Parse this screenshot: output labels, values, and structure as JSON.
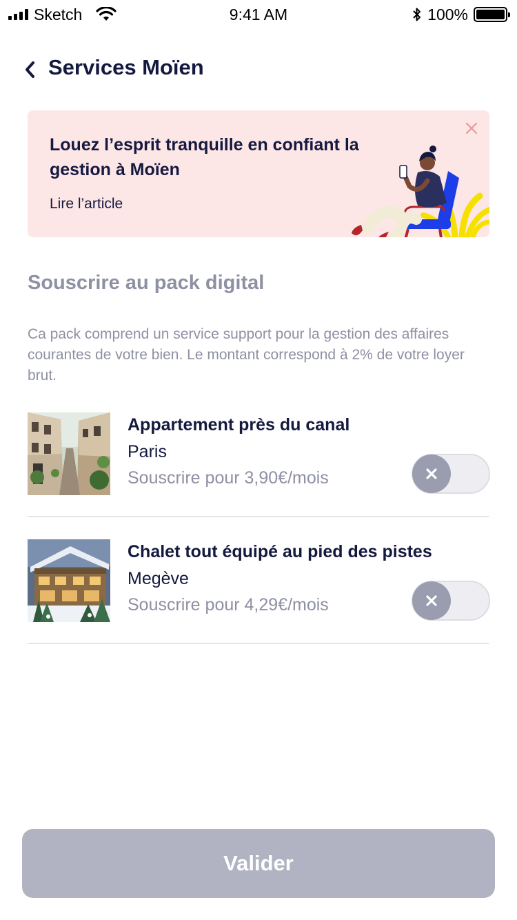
{
  "status_bar": {
    "carrier": "Sketch",
    "time": "9:41 AM",
    "battery": "100%"
  },
  "header": {
    "title": "Services Moïen",
    "back_icon": "chevron-left-icon"
  },
  "banner": {
    "title": "Louez l’esprit tranquille en confiant la gestion à Moïen",
    "link": "Lire l’article",
    "close_icon": "close-icon",
    "background": "#fde6e6"
  },
  "section": {
    "title": "Souscrire au pack digital",
    "description": "Ca pack comprend un service support pour la gestion des affaires courantes de votre bien. Le montant correspond à 2% de votre loyer brut."
  },
  "properties": [
    {
      "name": "Appartement près du canal",
      "city": "Paris",
      "price": "Souscrire pour 3,90€/mois",
      "subscribed": false
    },
    {
      "name": "Chalet tout équipé au pied des pistes",
      "city": "Megève",
      "price": "Souscrire pour 4,29€/mois",
      "subscribed": false
    }
  ],
  "footer": {
    "validate_label": "Valider"
  },
  "colors": {
    "primary_text": "#14193f",
    "muted_text": "#8e90a3",
    "button_disabled": "#b1b3c2"
  }
}
